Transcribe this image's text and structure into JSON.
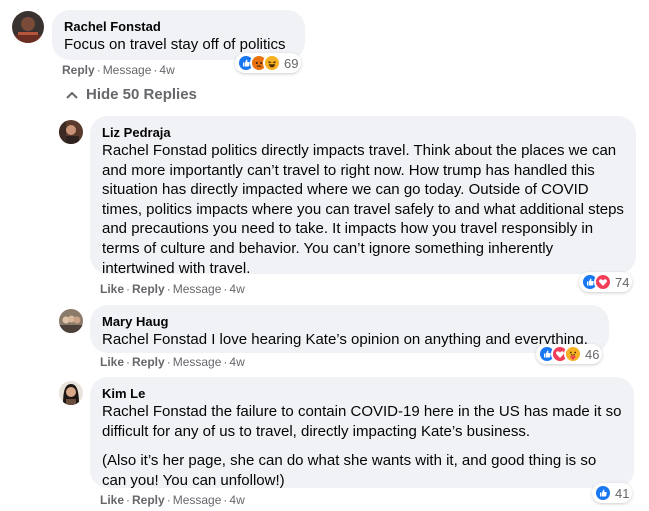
{
  "comments": [
    {
      "author": "Rachel Fonstad",
      "paragraphs": [
        "Focus on travel stay off of politics"
      ],
      "actions": [
        "Reply",
        "Message",
        "4w"
      ],
      "reactions": [
        "like",
        "angry",
        "haha"
      ],
      "reaction_count": "69"
    },
    {
      "author": "Liz Pedraja",
      "paragraphs": [
        "Rachel Fonstad politics directly impacts travel. Think about the places we can and more importantly can’t travel to right now. How trump has handled this situation has directly impacted where we can go today. Outside of COVID times, politics impacts where you can travel safely to and what additional steps and precautions you need to take. It impacts how you travel responsibly in terms of culture and behavior. You can’t ignore something inherently intertwined with travel."
      ],
      "actions": [
        "Like",
        "Reply",
        "Message",
        "4w"
      ],
      "reactions": [
        "like",
        "love"
      ],
      "reaction_count": "74"
    },
    {
      "author": "Mary Haug",
      "paragraphs": [
        "Rachel Fonstad I love hearing Kate’s opinion on anything and everything."
      ],
      "actions": [
        "Like",
        "Reply",
        "Message",
        "4w"
      ],
      "reactions": [
        "like",
        "love",
        "care"
      ],
      "reaction_count": "46"
    },
    {
      "author": "Kim Le",
      "paragraphs": [
        "Rachel Fonstad the failure to contain COVID-19 here in the US has made it so difficult for any of us to travel, directly impacting Kate’s business.",
        "(Also it’s her page, she can do what she wants with it, and good thing is so can you! You can unfollow!)"
      ],
      "actions": [
        "Like",
        "Reply",
        "Message",
        "4w"
      ],
      "reactions": [
        "like"
      ],
      "reaction_count": "41"
    }
  ],
  "hide_replies_label": "Hide 50 Replies",
  "colors": {
    "bubble": "#f0f2f5",
    "meta": "#65676b",
    "like": "#1877f2",
    "love": "#f33e58",
    "haha": "#f7b125",
    "angry": "#e9710f"
  }
}
